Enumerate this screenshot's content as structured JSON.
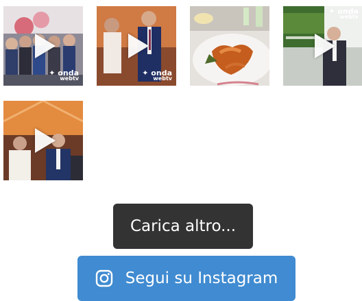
{
  "feed": {
    "posts": [
      {
        "type": "video",
        "logo": "onda webtv"
      },
      {
        "type": "video",
        "logo": "onda webtv"
      },
      {
        "type": "image"
      },
      {
        "type": "video",
        "logo": "onda webtv"
      },
      {
        "type": "video"
      }
    ]
  },
  "actions": {
    "load_more_label": "Carica altro...",
    "follow_label": "Segui su Instagram"
  },
  "colors": {
    "load_more_bg": "#333333",
    "follow_bg": "#408bd1"
  },
  "icons": {
    "follow": "instagram-icon",
    "video": "play-icon"
  }
}
